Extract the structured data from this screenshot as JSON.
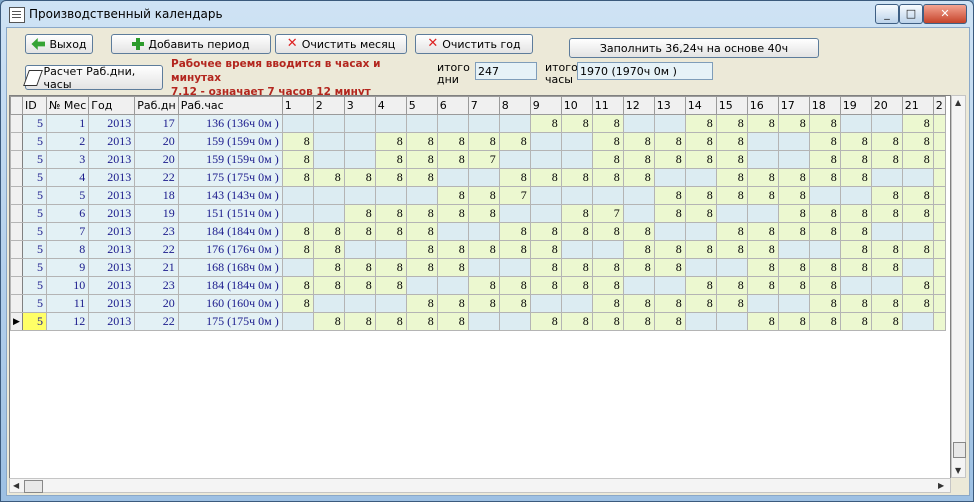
{
  "window": {
    "title": "Производственный календарь",
    "controls": [
      "_",
      "□",
      "✕"
    ]
  },
  "toolbar": {
    "exit": "Выход",
    "add_period": "Добавить период",
    "clear_month": "Очистить месяц",
    "clear_year": "Очистить год",
    "fill": "Заполнить 36,24ч на основе 40ч",
    "calc": "Расчет Раб.дни, часы"
  },
  "note": {
    "line1": "Рабочее время вводится в часах и минутах",
    "line2": "7,12 - означает 7 часов 12 минут"
  },
  "totals": {
    "days_label": "итого дни",
    "days_value": "247",
    "hours_label": "итого часы",
    "hours_value": "1970 (1970ч 0м )"
  },
  "grid": {
    "columns": [
      "ID",
      "№ Мес",
      "Год",
      "Раб.дн",
      "Раб.час",
      "1",
      "2",
      "3",
      "4",
      "5",
      "6",
      "7",
      "8",
      "9",
      "10",
      "11",
      "12",
      "13",
      "14",
      "15",
      "16",
      "17",
      "18",
      "19",
      "20",
      "21",
      "2"
    ],
    "rows": [
      {
        "id": "5",
        "mes": "1",
        "god": "2013",
        "dn": "17",
        "chas": "136 (136ч 0м )",
        "days": [
          "",
          "",
          "",
          "",
          "",
          "",
          "",
          "",
          "8",
          "8",
          "8",
          "",
          "",
          "8",
          "8",
          "8",
          "8",
          "8",
          "",
          "",
          "8"
        ]
      },
      {
        "id": "5",
        "mes": "2",
        "god": "2013",
        "dn": "20",
        "chas": "159 (159ч 0м )",
        "days": [
          "8",
          "",
          "",
          "8",
          "8",
          "8",
          "8",
          "8",
          "",
          "",
          "8",
          "8",
          "8",
          "8",
          "8",
          "",
          "",
          "8",
          "8",
          "8",
          "8"
        ]
      },
      {
        "id": "5",
        "mes": "3",
        "god": "2013",
        "dn": "20",
        "chas": "159 (159ч 0м )",
        "days": [
          "8",
          "",
          "",
          "8",
          "8",
          "8",
          "7",
          "",
          "",
          "",
          "8",
          "8",
          "8",
          "8",
          "8",
          "",
          "",
          "8",
          "8",
          "8",
          "8"
        ]
      },
      {
        "id": "5",
        "mes": "4",
        "god": "2013",
        "dn": "22",
        "chas": "175 (175ч 0м )",
        "days": [
          "8",
          "8",
          "8",
          "8",
          "8",
          "",
          "",
          "8",
          "8",
          "8",
          "8",
          "8",
          "",
          "",
          "8",
          "8",
          "8",
          "8",
          "8",
          "",
          ""
        ]
      },
      {
        "id": "5",
        "mes": "5",
        "god": "2013",
        "dn": "18",
        "chas": "143 (143ч 0м )",
        "days": [
          "",
          "",
          "",
          "",
          "",
          "8",
          "8",
          "7",
          "",
          "",
          "",
          "",
          "8",
          "8",
          "8",
          "8",
          "8",
          "",
          "",
          "8",
          "8"
        ]
      },
      {
        "id": "5",
        "mes": "6",
        "god": "2013",
        "dn": "19",
        "chas": "151 (151ч 0м )",
        "days": [
          "",
          "",
          "8",
          "8",
          "8",
          "8",
          "8",
          "",
          "",
          "8",
          "7",
          "",
          "8",
          "8",
          "",
          "",
          "8",
          "8",
          "8",
          "8",
          "8"
        ]
      },
      {
        "id": "5",
        "mes": "7",
        "god": "2013",
        "dn": "23",
        "chas": "184 (184ч 0м )",
        "days": [
          "8",
          "8",
          "8",
          "8",
          "8",
          "",
          "",
          "8",
          "8",
          "8",
          "8",
          "8",
          "",
          "",
          "8",
          "8",
          "8",
          "8",
          "8",
          "",
          ""
        ]
      },
      {
        "id": "5",
        "mes": "8",
        "god": "2013",
        "dn": "22",
        "chas": "176 (176ч 0м )",
        "days": [
          "8",
          "8",
          "",
          "",
          "8",
          "8",
          "8",
          "8",
          "8",
          "",
          "",
          "8",
          "8",
          "8",
          "8",
          "8",
          "",
          "",
          "8",
          "8",
          "8"
        ]
      },
      {
        "id": "5",
        "mes": "9",
        "god": "2013",
        "dn": "21",
        "chas": "168 (168ч 0м )",
        "days": [
          "",
          "8",
          "8",
          "8",
          "8",
          "8",
          "",
          "",
          "8",
          "8",
          "8",
          "8",
          "8",
          "",
          "",
          "8",
          "8",
          "8",
          "8",
          "8",
          ""
        ]
      },
      {
        "id": "5",
        "mes": "10",
        "god": "2013",
        "dn": "23",
        "chas": "184 (184ч 0м )",
        "days": [
          "8",
          "8",
          "8",
          "8",
          "",
          "",
          "8",
          "8",
          "8",
          "8",
          "8",
          "",
          "",
          "8",
          "8",
          "8",
          "8",
          "8",
          "",
          "",
          "8"
        ]
      },
      {
        "id": "5",
        "mes": "11",
        "god": "2013",
        "dn": "20",
        "chas": "160 (160ч 0м )",
        "days": [
          "8",
          "",
          "",
          "",
          "8",
          "8",
          "8",
          "8",
          "",
          "",
          "8",
          "8",
          "8",
          "8",
          "8",
          "",
          "",
          "8",
          "8",
          "8",
          "8"
        ]
      },
      {
        "id": "5",
        "mes": "12",
        "god": "2013",
        "dn": "22",
        "chas": "175 (175ч 0м )",
        "days": [
          "",
          "8",
          "8",
          "8",
          "8",
          "8",
          "",
          "",
          "8",
          "8",
          "8",
          "8",
          "8",
          "",
          "",
          "8",
          "8",
          "8",
          "8",
          "8",
          ""
        ]
      }
    ]
  },
  "colors": {
    "workday": "#ecf8d0",
    "weekend": "#dcecf2",
    "selected": "#ffff66",
    "note": "#b3261e"
  }
}
